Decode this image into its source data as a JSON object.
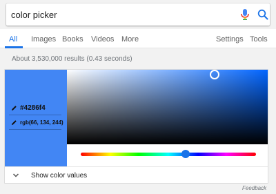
{
  "search": {
    "query": "color picker"
  },
  "tabs": [
    {
      "label": "All"
    },
    {
      "label": "Images"
    },
    {
      "label": "Books"
    },
    {
      "label": "Videos"
    },
    {
      "label": "More"
    },
    {
      "label": "Settings"
    },
    {
      "label": "Tools"
    }
  ],
  "results_stats": "About 3,530,000 results (0.43 seconds)",
  "color_picker": {
    "hex": "#4286f4",
    "rgb": "rgb(66, 134, 244)",
    "show_values_label": "Show color values"
  },
  "feedback": "Feedback",
  "colors": {
    "accent": "#1a73e8",
    "swatch": "#4286f4"
  }
}
